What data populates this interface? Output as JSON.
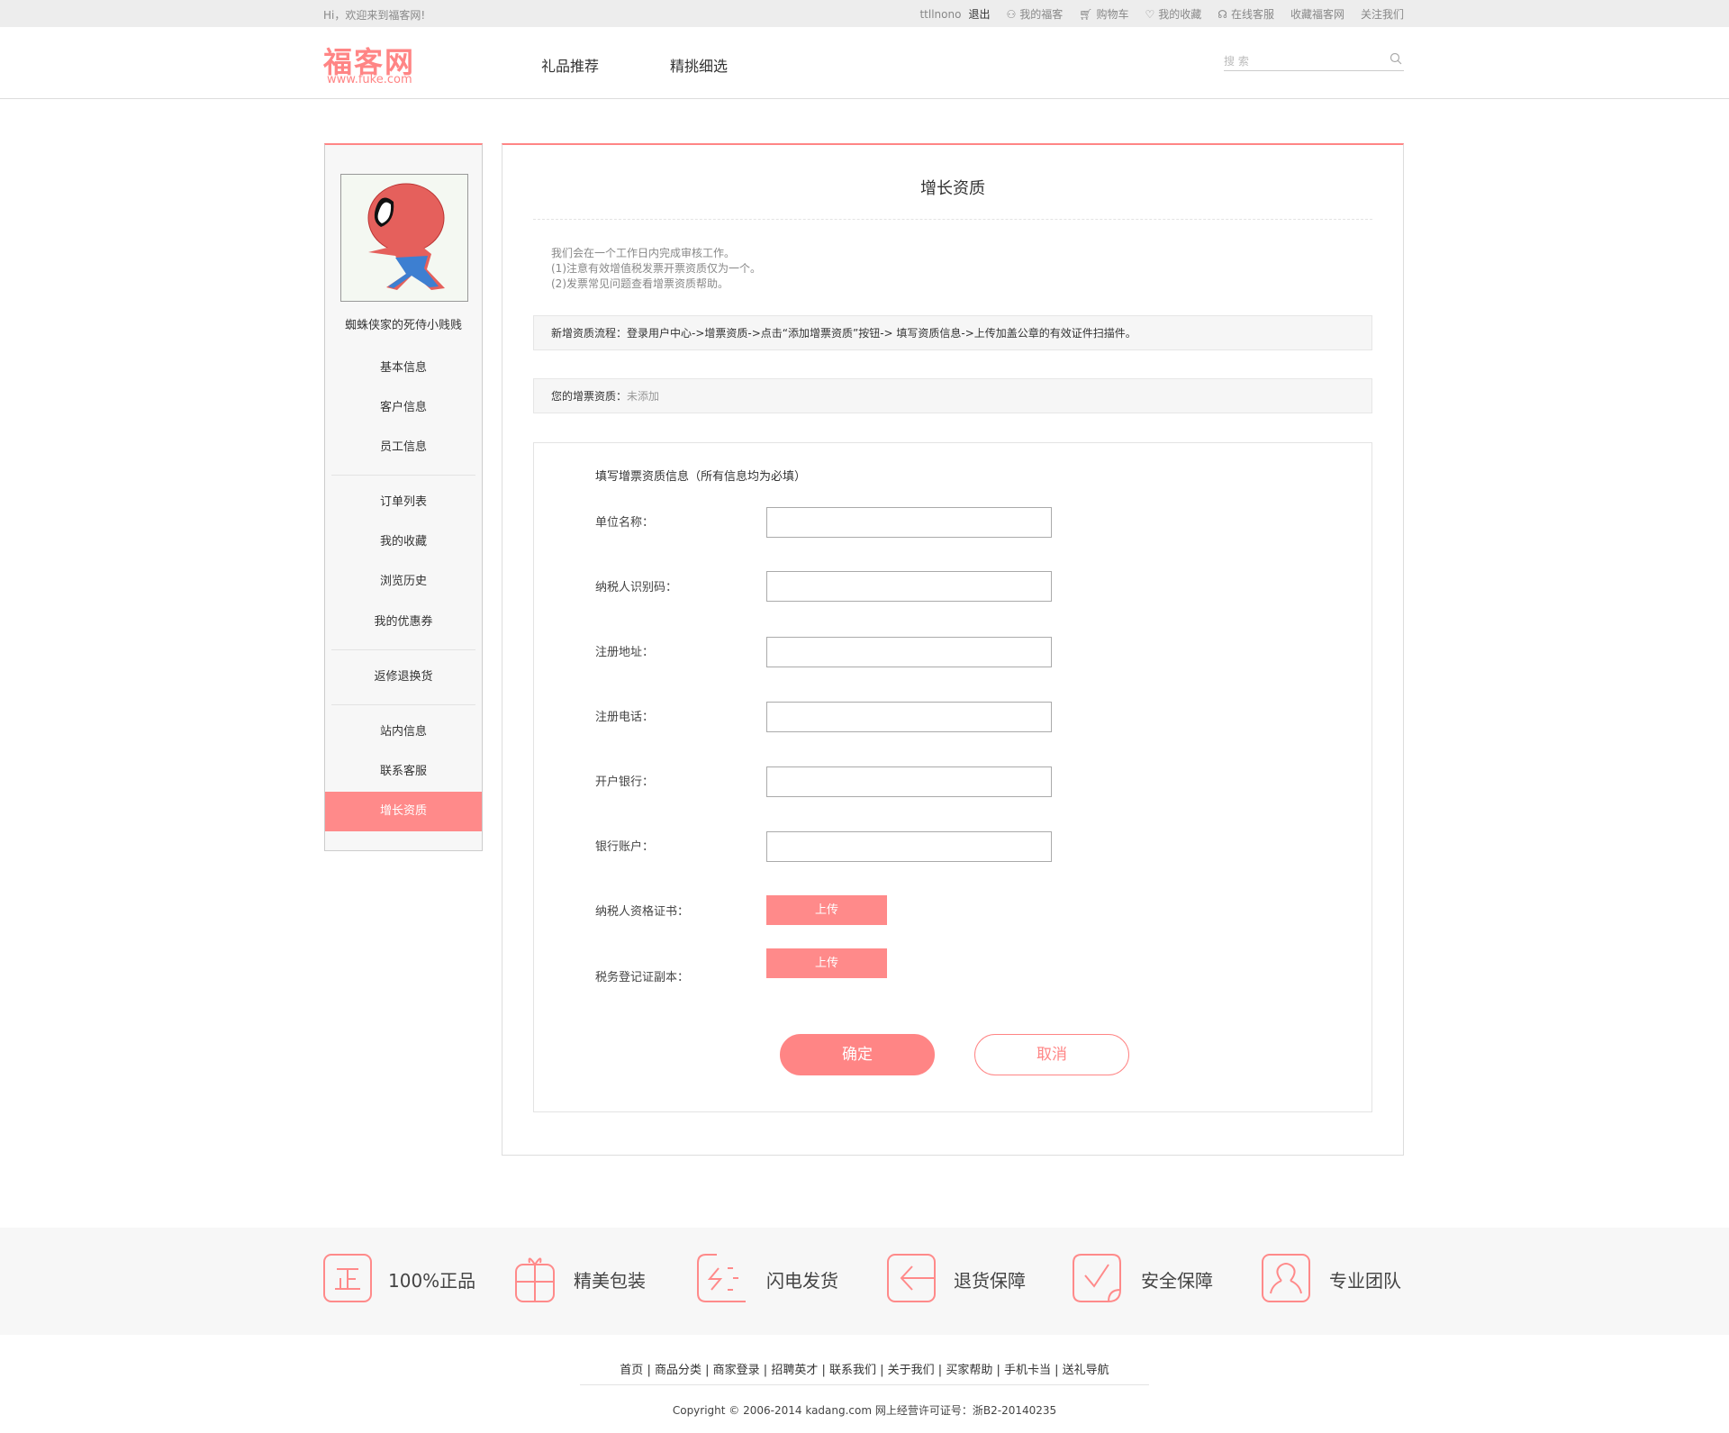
{
  "topbar": {
    "welcome": "Hi，欢迎来到福客网!",
    "username": "ttllnono",
    "logout": "退出",
    "links": [
      {
        "icon": "user-icon",
        "label": "我的福客"
      },
      {
        "icon": "cart-icon",
        "label": "购物车"
      },
      {
        "icon": "heart-icon",
        "label": "我的收藏"
      },
      {
        "icon": "headset-icon",
        "label": "在线客服"
      },
      {
        "icon": "",
        "label": "收藏福客网"
      },
      {
        "icon": "",
        "label": "关注我们"
      }
    ]
  },
  "header": {
    "logo": "福客网",
    "logo_url": "www.fuke.com",
    "nav": [
      "礼品推荐",
      "精挑细选"
    ],
    "search_placeholder": "搜 索"
  },
  "sidebar": {
    "username": "蜘蛛侠家的死侍小贱贱",
    "groups": [
      [
        "基本信息",
        "客户信息",
        "员工信息"
      ],
      [
        "订单列表",
        "我的收藏",
        "浏览历史",
        "我的优惠券"
      ],
      [
        "返修退换货"
      ],
      [
        "站内信息",
        "联系客服",
        "增长资质"
      ]
    ],
    "active": "增长资质"
  },
  "main": {
    "title": "增长资质",
    "notes": [
      "我们会在一个工作日内完成审核工作。",
      "(1)注意有效增值税发票开票资质仅为一个。",
      "(2)发票常见问题查看增票资质帮助。"
    ],
    "flow": "新增资质流程：登录用户中心->增票资质->点击“添加增票资质”按钮-> 填写资质信息->上传加盖公章的有效证件扫描件。",
    "status_label": "您的增票资质：",
    "status_value": "未添加",
    "form": {
      "title": "填写增票资质信息（所有信息均为必填）",
      "fields": [
        {
          "label": "单位名称：",
          "value": ""
        },
        {
          "label": "纳税人识别码：",
          "value": ""
        },
        {
          "label": "注册地址：",
          "value": ""
        },
        {
          "label": "注册电话：",
          "value": ""
        },
        {
          "label": "开户银行：",
          "value": ""
        },
        {
          "label": "银行账户：",
          "value": ""
        }
      ],
      "uploads": [
        {
          "label": "纳税人资格证书：",
          "button": "上传"
        },
        {
          "label": "税务登记证副本：",
          "button": "上传"
        }
      ],
      "confirm": "确定",
      "cancel": "取消"
    }
  },
  "features": [
    {
      "icon": "authentic-icon",
      "label": "100%正品"
    },
    {
      "icon": "gift-icon",
      "label": "精美包装"
    },
    {
      "icon": "lightning-icon",
      "label": "闪电发货"
    },
    {
      "icon": "return-icon",
      "label": "退货保障"
    },
    {
      "icon": "check-icon",
      "label": "安全保障"
    },
    {
      "icon": "team-icon",
      "label": "专业团队"
    }
  ],
  "footer": {
    "links": [
      "首页",
      "商品分类",
      "商家登录",
      "招聘英才",
      "联系我们",
      "关于我们",
      "买家帮助",
      "手机卡当",
      "送礼导航"
    ],
    "copyright": "Copyright © 2006-2014 kadang.com 网上经营许可证号：浙B2-20140235"
  },
  "colors": {
    "accent": "#ff8a8a",
    "topbar": "#ededed",
    "band": "#f7f7f7"
  }
}
